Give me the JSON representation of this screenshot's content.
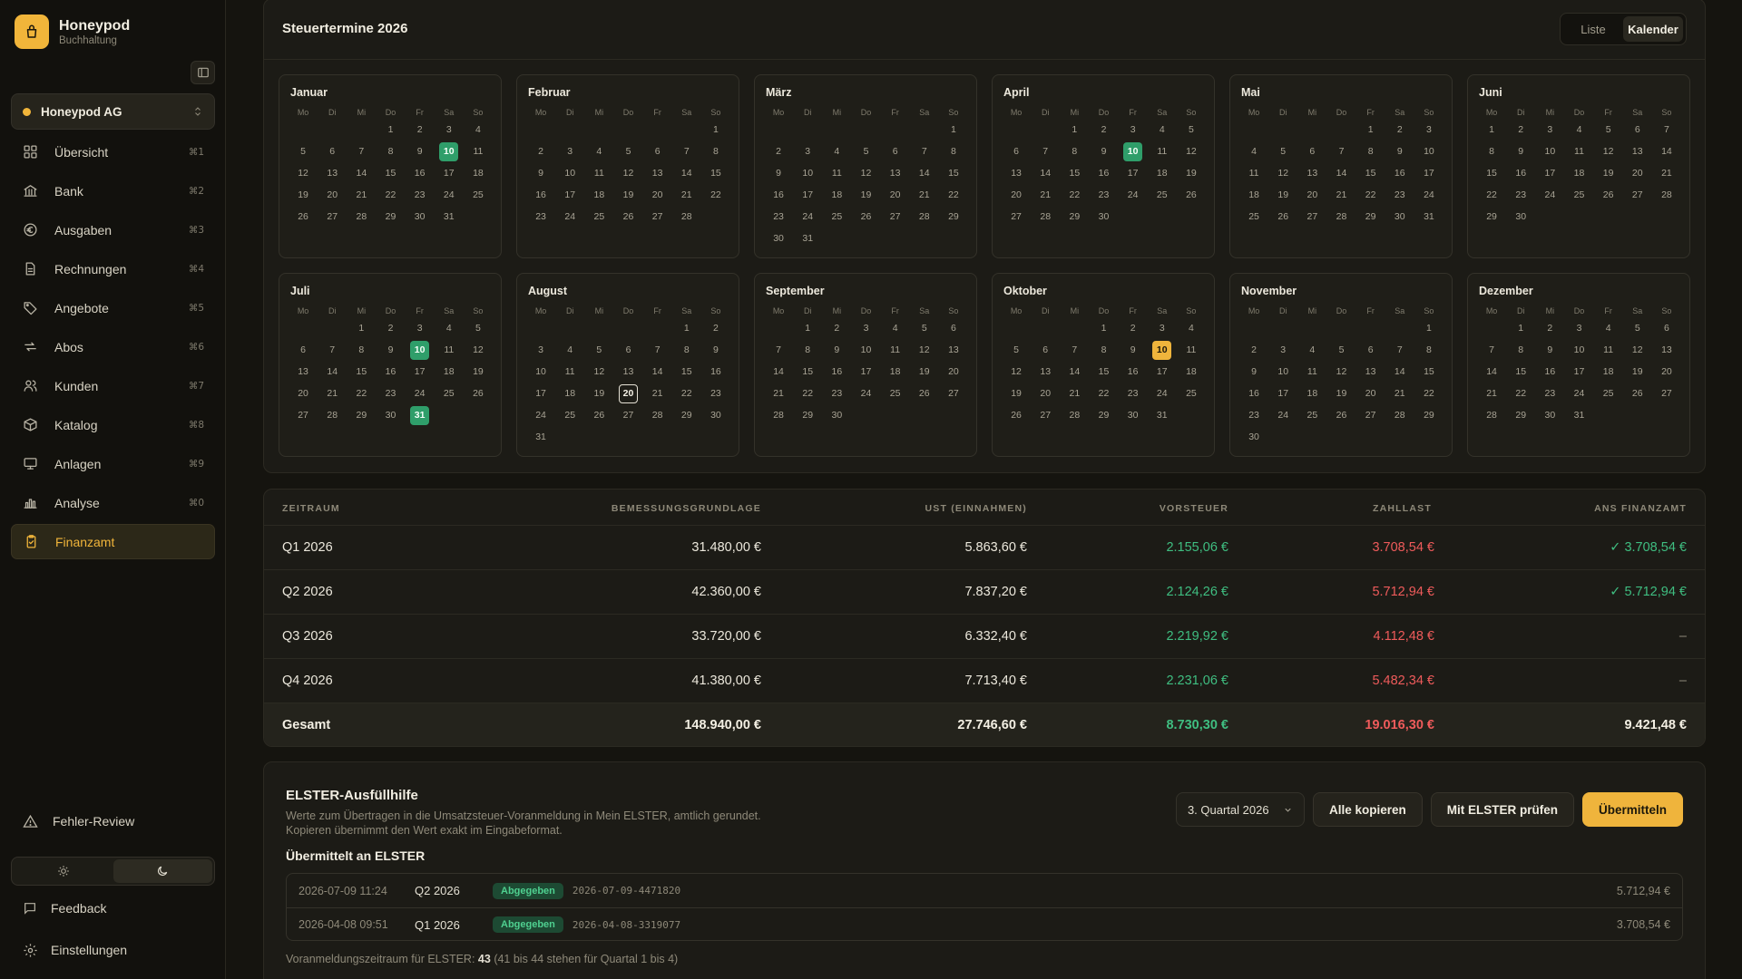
{
  "brand": {
    "name": "Honeypod",
    "subtitle": "Buchhaltung"
  },
  "company": {
    "name": "Honeypod AG"
  },
  "nav": [
    {
      "label": "Übersicht",
      "kbd": "⌘1",
      "icon": "dashboard-icon"
    },
    {
      "label": "Bank",
      "kbd": "⌘2",
      "icon": "bank-icon"
    },
    {
      "label": "Ausgaben",
      "kbd": "⌘3",
      "icon": "euro-icon"
    },
    {
      "label": "Rechnungen",
      "kbd": "⌘4",
      "icon": "document-icon"
    },
    {
      "label": "Angebote",
      "kbd": "⌘5",
      "icon": "tag-icon"
    },
    {
      "label": "Abos",
      "kbd": "⌘6",
      "icon": "repeat-icon"
    },
    {
      "label": "Kunden",
      "kbd": "⌘7",
      "icon": "users-icon"
    },
    {
      "label": "Katalog",
      "kbd": "⌘8",
      "icon": "box-icon"
    },
    {
      "label": "Anlagen",
      "kbd": "⌘9",
      "icon": "monitor-icon"
    },
    {
      "label": "Analyse",
      "kbd": "⌘0",
      "icon": "chart-icon"
    },
    {
      "label": "Finanzamt",
      "kbd": "",
      "icon": "clipboard-icon",
      "active": true
    }
  ],
  "footer": {
    "fehler": "Fehler-Review",
    "feedback": "Feedback",
    "settings": "Einstellungen"
  },
  "calendar": {
    "title": "Steuertermine 2026",
    "view_list": "Liste",
    "view_calendar": "Kalender",
    "weekdays": [
      "Mo",
      "Di",
      "Mi",
      "Do",
      "Fr",
      "Sa",
      "So"
    ],
    "months": [
      {
        "name": "Januar",
        "offset": 3,
        "days": 31,
        "green": [
          10
        ],
        "yellow": [],
        "today": []
      },
      {
        "name": "Februar",
        "offset": 6,
        "days": 28,
        "green": [],
        "yellow": [],
        "today": []
      },
      {
        "name": "März",
        "offset": 6,
        "days": 31,
        "green": [],
        "yellow": [],
        "today": []
      },
      {
        "name": "April",
        "offset": 2,
        "days": 30,
        "green": [
          10
        ],
        "yellow": [],
        "today": []
      },
      {
        "name": "Mai",
        "offset": 4,
        "days": 31,
        "green": [],
        "yellow": [],
        "today": []
      },
      {
        "name": "Juni",
        "offset": 0,
        "days": 30,
        "green": [],
        "yellow": [],
        "today": []
      },
      {
        "name": "Juli",
        "offset": 2,
        "days": 31,
        "green": [
          10,
          31
        ],
        "yellow": [],
        "today": []
      },
      {
        "name": "August",
        "offset": 5,
        "days": 31,
        "green": [],
        "yellow": [],
        "today": [
          20
        ]
      },
      {
        "name": "September",
        "offset": 1,
        "days": 30,
        "green": [],
        "yellow": [],
        "today": []
      },
      {
        "name": "Oktober",
        "offset": 3,
        "days": 31,
        "green": [],
        "yellow": [
          10
        ],
        "today": []
      },
      {
        "name": "November",
        "offset": 6,
        "days": 30,
        "green": [],
        "yellow": [],
        "today": []
      },
      {
        "name": "Dezember",
        "offset": 1,
        "days": 31,
        "green": [],
        "yellow": [],
        "today": []
      }
    ]
  },
  "table": {
    "headers": [
      "ZEITRAUM",
      "BEMESSUNGSGRUNDLAGE",
      "UST (EINNAHMEN)",
      "VORSTEUER",
      "ZAHLLAST",
      "ANS FINANZAMT"
    ],
    "rows": [
      {
        "period": "Q1 2026",
        "basis": "31.480,00 €",
        "ust": "5.863,60 €",
        "vorsteuer": "2.155,06 €",
        "zahllast": "3.708,54 €",
        "finanzamt": "✓ 3.708,54 €",
        "paid": true
      },
      {
        "period": "Q2 2026",
        "basis": "42.360,00 €",
        "ust": "7.837,20 €",
        "vorsteuer": "2.124,26 €",
        "zahllast": "5.712,94 €",
        "finanzamt": "✓ 5.712,94 €",
        "paid": true
      },
      {
        "period": "Q3 2026",
        "basis": "33.720,00 €",
        "ust": "6.332,40 €",
        "vorsteuer": "2.219,92 €",
        "zahllast": "4.112,48 €",
        "finanzamt": "–",
        "paid": false
      },
      {
        "period": "Q4 2026",
        "basis": "41.380,00 €",
        "ust": "7.713,40 €",
        "vorsteuer": "2.231,06 €",
        "zahllast": "5.482,34 €",
        "finanzamt": "–",
        "paid": false
      }
    ],
    "total": {
      "period": "Gesamt",
      "basis": "148.940,00 €",
      "ust": "27.746,60 €",
      "vorsteuer": "8.730,30 €",
      "zahllast": "19.016,30 €",
      "finanzamt": "9.421,48 €"
    }
  },
  "elster": {
    "title": "ELSTER-Ausfüllhilfe",
    "desc_line1": "Werte zum Übertragen in die Umsatzsteuer-Voranmeldung in Mein ELSTER, amtlich gerundet.",
    "desc_line2": "Kopieren übernimmt den Wert exakt im Eingabeformat.",
    "quarter_select": "3. Quartal 2026",
    "copy_all": "Alle kopieren",
    "check": "Mit ELSTER prüfen",
    "submit": "Übermitteln",
    "submitted_title": "Übermittelt an ELSTER",
    "submissions": [
      {
        "date": "2026-07-09 11:24",
        "quarter": "Q2 2026",
        "status": "Abgegeben",
        "ref": "2026-07-09-4471820",
        "amount": "5.712,94 €"
      },
      {
        "date": "2026-04-08 09:51",
        "quarter": "Q1 2026",
        "status": "Abgegeben",
        "ref": "2026-04-08-3319077",
        "amount": "3.708,54 €"
      }
    ],
    "footer_prefix": "Voranmeldungszeitraum für ELSTER:",
    "footer_value": "43",
    "footer_suffix": "(41 bis 44 stehen für Quartal 1 bis 4)"
  },
  "colors": {
    "accent": "#efb43c",
    "positive": "#3fbe81",
    "negative": "#ef5b5b"
  }
}
